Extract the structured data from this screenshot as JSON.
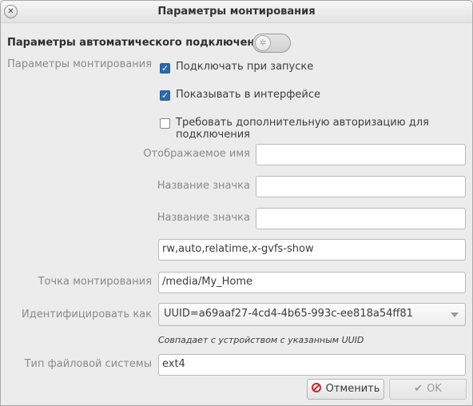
{
  "window": {
    "title": "Параметры монтирования",
    "close_glyph": "✕"
  },
  "auto_connect": {
    "label": "Параметры автоматического подключения",
    "toggle_on": false
  },
  "mount_params": {
    "label": "Параметры монтирования",
    "options": [
      {
        "label": "Подключать при запуске",
        "checked": true
      },
      {
        "label": "Показывать в интерфейсе",
        "checked": true
      },
      {
        "label": "Требовать дополнительную авторизацию для подключения",
        "checked": false
      }
    ]
  },
  "fields": {
    "display_name": {
      "label": "Отображаемое имя",
      "value": ""
    },
    "icon_name_1": {
      "label": "Название значка",
      "value": ""
    },
    "icon_name_2": {
      "label": "Название значка",
      "value": ""
    },
    "mount_options": {
      "value": "rw,auto,relatime,x-gvfs-show"
    },
    "mount_point": {
      "label": "Точка монтирования",
      "value": "/media/My_Home"
    },
    "identify_as": {
      "label": "Идентифицировать как",
      "value": "UUID=a69aaf27-4cd4-4b65-993c-ee818a54ff81",
      "hint": "Совпадает с устройством с указанным UUID"
    },
    "fs_type": {
      "label": "Тип файловой системы",
      "value": "ext4"
    }
  },
  "buttons": {
    "cancel": "Отменить",
    "ok": "OK",
    "ok_glyph": "✔",
    "check_glyph": "✓"
  },
  "colors": {
    "checkbox_accent": "#2c6aa8",
    "cancel_icon": "#cc2b2b"
  }
}
